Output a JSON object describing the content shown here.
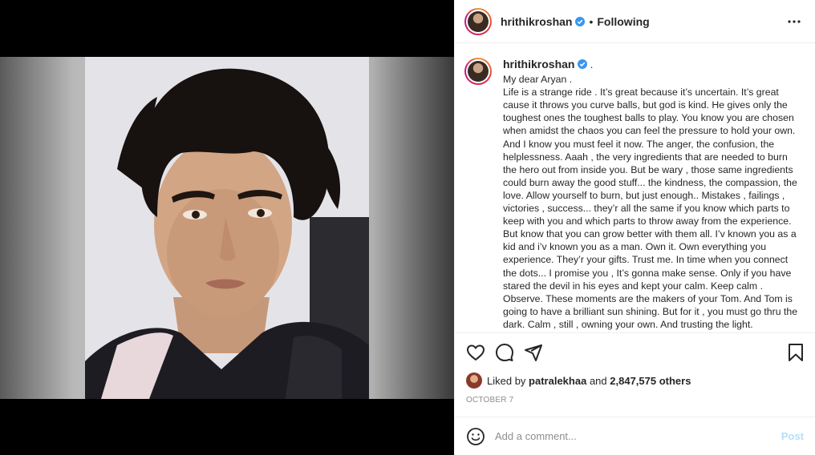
{
  "header": {
    "username": "hrithikroshan",
    "separator": "•",
    "follow_status": "Following"
  },
  "caption": {
    "username": "hrithikroshan",
    "trailing": " .",
    "text": "My dear Aryan .\nLife is a strange ride . It’s great because it’s uncertain. It’s great cause it throws you curve balls, but god is kind. He gives only the toughest ones the toughest balls to play. You know you are chosen when amidst the chaos you can feel the pressure to hold your own. And I know you must feel it now. The anger, the confusion, the helplessness. Aaah , the very ingredients that are needed to burn the hero out from inside you. But be wary , those same ingredients could burn away the good stuff... the kindness, the compassion, the love. Allow yourself to burn, but just enough.. Mistakes , failings , victories , success... they’r all the same if you know which parts to keep with you and which parts to throw away from the experience. But know that you can grow better with them all. I’v known you as a kid and i’v known you as a man. Own it. Own everything you experience. They’r your gifts. Trust me. In time when you connect the dots... I promise you , It’s gonna make sense. Only if you have stared the devil in his eyes and kept your calm. Keep calm . Observe. These moments are the makers of your Tom. And Tom is going to have a brilliant sun shining. But for it , you must go thru the dark. Calm , still , owning your own. And trusting the light."
  },
  "likes": {
    "prefix": "Liked by",
    "user": "patralekhaa",
    "conjunction": "and",
    "others": "2,847,575 others"
  },
  "date": "OCTOBER 7",
  "comment": {
    "placeholder": "Add a comment...",
    "post_label": "Post"
  },
  "icons": {
    "like": "heart-icon",
    "comment": "comment-icon",
    "share": "share-icon",
    "save": "bookmark-icon",
    "emoji": "emoji-icon",
    "more": "more-options-icon",
    "verified": "verified-badge-icon"
  },
  "colors": {
    "verified": "#3897f0",
    "post_button": "#b2dffc",
    "muted": "#8e8e8e",
    "text": "#262626"
  }
}
